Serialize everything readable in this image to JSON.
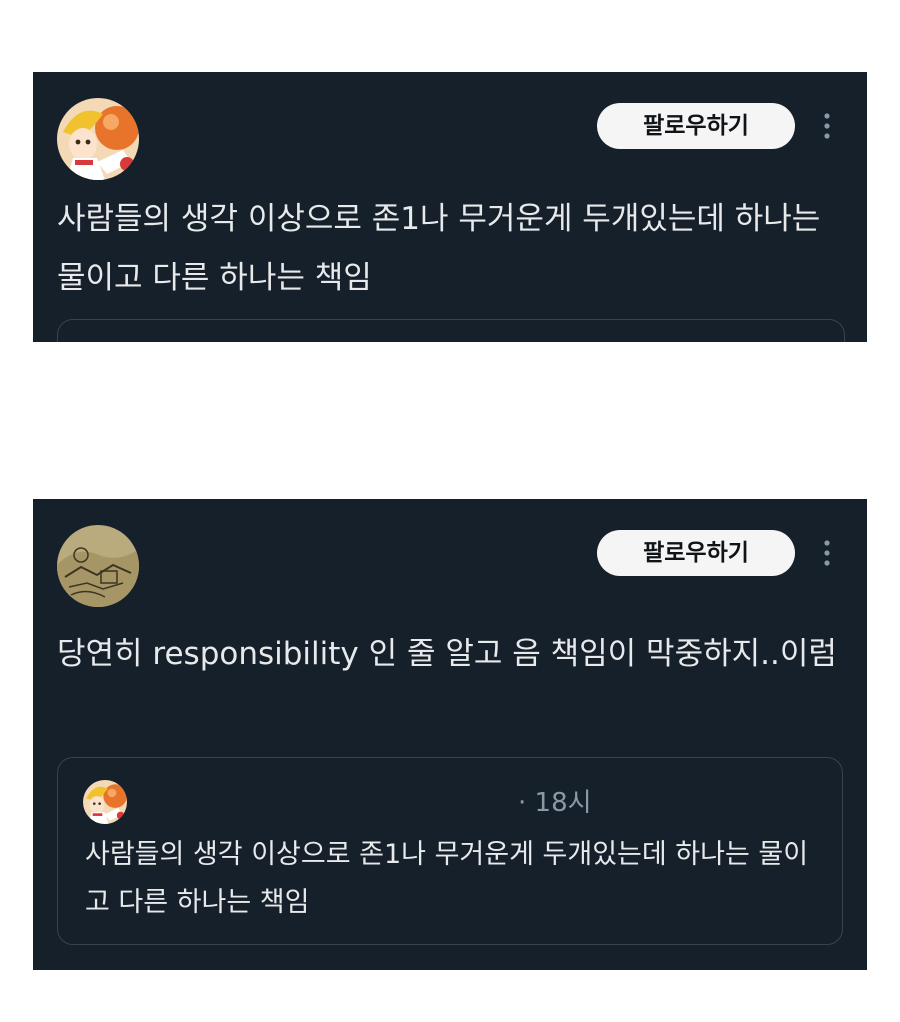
{
  "tweets": [
    {
      "follow_label": "팔로우하기",
      "text": "사람들의 생각 이상으로 존1나 무거운게 두개있는데 하나는 물이고 다른 하나는 책임",
      "avatar_icon": "anime-character-avatar"
    },
    {
      "follow_label": "팔로우하기",
      "text": "당연히 responsibility 인 줄 알고 음 책임이 막중하지..이럼",
      "avatar_icon": "sketch-illustration-avatar",
      "quote": {
        "time": "· 18시",
        "text": "사람들의 생각 이상으로 존1나 무거운게 두개있는데 하나는 물이고 다른 하나는 책임"
      }
    }
  ],
  "colors": {
    "card_background": "#15202b",
    "page_background": "#ffffff",
    "text_primary": "#e7e9ea",
    "text_secondary": "#8b98a5",
    "follow_button_bg": "#f5f5f5",
    "border": "#38444d"
  }
}
